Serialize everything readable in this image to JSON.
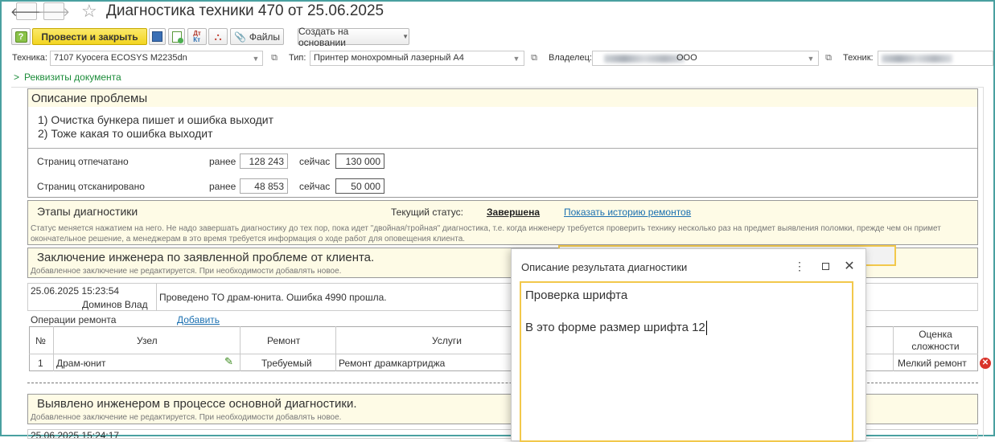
{
  "window": {
    "title": "Диагностика техники 470 от 25.06.2025"
  },
  "toolbar": {
    "post_close": "Провести и закрыть",
    "files": "Файлы",
    "create_based": "Создать на основании"
  },
  "header": {
    "equipment_label": "Техника:",
    "equipment_value": "7107 Kyocera ECOSYS M2235dn",
    "type_label": "Тип:",
    "type_value": "Принтер монохромный лазерный А4",
    "owner_label": "Владелец:",
    "owner_suffix": "ООО",
    "tech_label": "Техник:"
  },
  "requisites_link": "Реквизиты документа",
  "problem": {
    "title": "Описание проблемы",
    "lines": [
      "1) Очистка бункера пишет и ошибка выходит",
      "2) Тоже какая то ошибка выходит"
    ],
    "printed_label": "Страниц отпечатано",
    "scanned_label": "Страниц отсканировано",
    "before_label": "ранее",
    "now_label": "сейчас",
    "printed_before": "128 243",
    "printed_now": "130 000",
    "scanned_before": "48 853",
    "scanned_now": "50 000"
  },
  "stages": {
    "title": "Этапы диагностики",
    "status_label": "Текущий статус:",
    "status_value": "Завершена",
    "history_link": "Показать историю ремонтов",
    "note": "Статус меняется нажатием на него. Не надо завершать диагностику до тех пор, пока идет \"двойная/тройная\" диагностика, т.е. когда инженеру требуется проверить технику несколько раз на предмет выявления поломки, прежде чем он примет окончательное решение, а менеджерам в это время требуется информация о ходе работ для оповещения клиента."
  },
  "conclusion": {
    "title": "Заключение инженера по заявленной проблеме от клиента.",
    "note": "Добавленное заключение не редактируется. При необходимости добавлять новое.",
    "date": "25.06.2025 15:23:54",
    "author": "Доминов Влад",
    "text": "Проведено ТО драм-юнита. Ошибка 4990 прошла."
  },
  "operations": {
    "label": "Операции ремонта",
    "add_link": "Добавить",
    "columns": [
      "№",
      "Узел",
      "Ремонт",
      "Услуги",
      "Оценка сложности"
    ],
    "rows": [
      {
        "num": "1",
        "node": "Драм-юнит",
        "repair": "Требуемый",
        "service": "Ремонт драмкартриджа",
        "complexity": "Мелкий ремонт"
      }
    ]
  },
  "found": {
    "title": "Выявлено инженером в процессе основной диагностики.",
    "note": "Добавленное заключение не редактируется. При необходимости добавлять новое.",
    "date_partial": "25.06.2025 15:24:17"
  },
  "dialog": {
    "title": "Описание результата диагностики",
    "line1": "Проверка шрифта",
    "line2": "В это форме размер шрифта 12"
  },
  "colors": {
    "accent_yellow": "#f2d421",
    "link": "#1a6fb0",
    "green": "#1c8c3a",
    "frame": "#49a0a0",
    "section_bg": "#fefbe6"
  }
}
